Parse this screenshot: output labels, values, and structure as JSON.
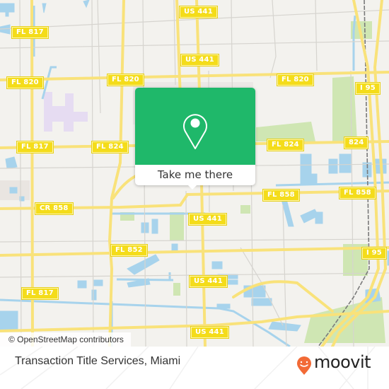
{
  "map": {
    "colors": {
      "land": "#f3f2ee",
      "road": "#f9e27a",
      "road_casing": "#ecd45a",
      "minor_road": "#d6d4cf",
      "water": "#a7d3ec",
      "park": "#cfe6b3",
      "landuse_purple": "#e6dcf2",
      "rail": "#7a7a7a"
    },
    "road_labels": [
      {
        "id": "us441-top",
        "text": "US 441"
      },
      {
        "id": "fl817-top",
        "text": "FL 817"
      },
      {
        "id": "us441-second",
        "text": "US 441"
      },
      {
        "id": "fl820-left",
        "text": "FL 820"
      },
      {
        "id": "fl820-mid",
        "text": "FL 820"
      },
      {
        "id": "fl820-right",
        "text": "FL 820"
      },
      {
        "id": "i95-top",
        "text": "I 95"
      },
      {
        "id": "fl817-mid",
        "text": "FL 817"
      },
      {
        "id": "fl824-left",
        "text": "FL 824"
      },
      {
        "id": "fl824-right",
        "text": "FL 824"
      },
      {
        "id": "sr824",
        "text": "824"
      },
      {
        "id": "cr858",
        "text": "CR 858"
      },
      {
        "id": "fl858-mid",
        "text": "FL 858"
      },
      {
        "id": "fl858-right",
        "text": "FL 858"
      },
      {
        "id": "us441-mid",
        "text": "US 441"
      },
      {
        "id": "fl852",
        "text": "FL 852"
      },
      {
        "id": "i95-bottom",
        "text": "I 95"
      },
      {
        "id": "us441-lower",
        "text": "US 441"
      },
      {
        "id": "fl817-bottom",
        "text": "FL 817"
      },
      {
        "id": "us441-bottom",
        "text": "US 441"
      }
    ],
    "attribution": "© OpenStreetMap contributors",
    "popup": {
      "icon": "map-pin-icon",
      "button_label": "Take me there",
      "accent": "#1fb86a"
    }
  },
  "footer": {
    "place_name": "Transaction Title Services, Miami",
    "brand": {
      "name": "moovit",
      "icon": "moovit-pin-icon",
      "color": "#f26a36"
    }
  }
}
